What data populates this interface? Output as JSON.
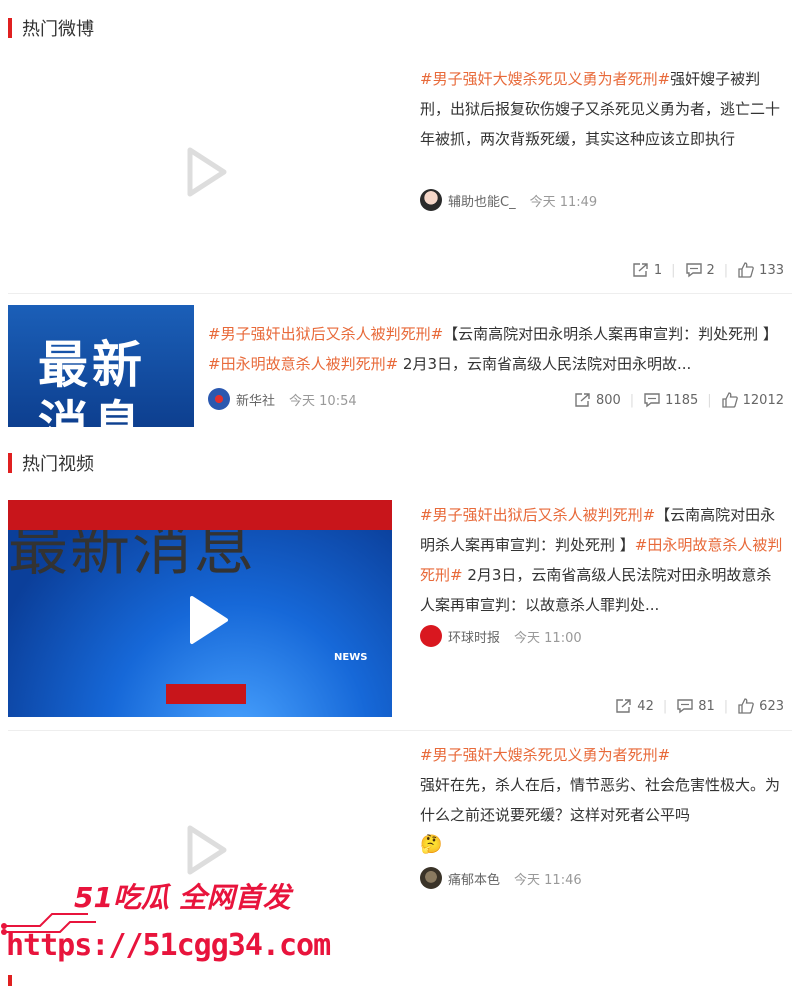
{
  "sections": {
    "hot_weibo": "热门微博",
    "hot_video": "热门视频",
    "cut_off": "..."
  },
  "posts": [
    {
      "tag": "#男子强奸大嫂杀死见义勇为者死刑#",
      "text": "强奸嫂子被判刑，出狱后报复砍伤嫂子又杀死见义勇为者，逃亡二十年被抓，两次背叛死缓，其实这种应该立即执行",
      "author": "辅助也能C_",
      "time": "今天 11:49",
      "shares": "1",
      "comments": "2",
      "likes": "133"
    },
    {
      "tag1": "#男子强奸出狱后又杀人被判死刑#",
      "text1": "【云南高院对田永明杀人案再审宣判：判处死刑 】",
      "tag2": "#田永明故意杀人被判死刑#",
      "text2": " 2月3日，云南省高级人民法院对田永明故...",
      "author": "新华社",
      "time": "今天 10:54",
      "shares": "800",
      "comments": "1185",
      "likes": "12012",
      "thumb_text_1": "最新",
      "thumb_text_2": "消息"
    },
    {
      "tag1": "#男子强奸出狱后又杀人被判死刑#",
      "text1": "【云南高院对田永明杀人案再审宣判：判处死刑 】",
      "tag2": "#田永明故意杀人被判死刑#",
      "text2": " 2月3日，云南省高级人民法院对田永明故意杀人案再审宣判：以故意杀人罪判处...",
      "author": "环球时报",
      "time": "今天 11:00",
      "shares": "42",
      "comments": "81",
      "likes": "623",
      "thumb_text": "最新消息",
      "thumb_news": "NEWS"
    },
    {
      "tag": "#男子强奸大嫂杀死见义勇为者死刑#",
      "text": "强奸在先，杀人在后，情节恶劣、社会危害性极大。为什么之前还说要死缓？这样对死者公平吗",
      "emoji": "🤔",
      "author": "痛郁本色",
      "time": "今天 11:46"
    }
  ],
  "watermark": {
    "title": "51吃瓜 全网首发",
    "url": "https://51cgg34.com"
  },
  "colors": {
    "accent": "#e02020",
    "tag": "#e86a3a",
    "watermark": "#e8143c"
  }
}
